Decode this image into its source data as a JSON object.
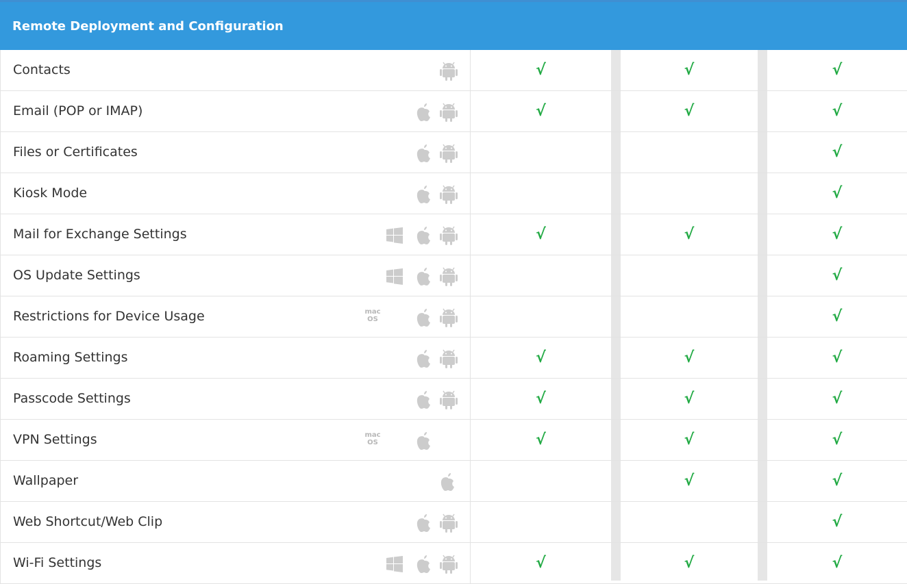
{
  "header": {
    "title": "Remote Deployment and Configuration"
  },
  "check_symbol": "√",
  "colors": {
    "header_bg": "#3399dd",
    "check": "#22aa44",
    "icon": "#cccccc",
    "gap": "#e6e6e6"
  },
  "rows": [
    {
      "label": "Contacts",
      "platforms": [
        "android-icon"
      ],
      "checks": [
        true,
        true,
        true
      ]
    },
    {
      "label": "Email (POP or IMAP)",
      "platforms": [
        "apple-icon",
        "android-icon"
      ],
      "checks": [
        true,
        true,
        true
      ]
    },
    {
      "label": "Files or Certificates",
      "platforms": [
        "apple-icon",
        "android-icon"
      ],
      "checks": [
        false,
        false,
        true
      ]
    },
    {
      "label": "Kiosk Mode",
      "platforms": [
        "apple-icon",
        "android-icon"
      ],
      "checks": [
        false,
        false,
        true
      ]
    },
    {
      "label": "Mail for Exchange Settings",
      "platforms": [
        "windows-icon",
        "apple-icon",
        "android-icon"
      ],
      "checks": [
        true,
        true,
        true
      ]
    },
    {
      "label": "OS Update Settings",
      "platforms": [
        "windows-icon",
        "apple-icon",
        "android-icon"
      ],
      "checks": [
        false,
        false,
        true
      ]
    },
    {
      "label": "Restrictions for Device Usage",
      "platforms": [
        "macos-icon",
        "apple-icon",
        "android-icon"
      ],
      "checks": [
        false,
        false,
        true
      ]
    },
    {
      "label": "Roaming Settings",
      "platforms": [
        "apple-icon",
        "android-icon"
      ],
      "checks": [
        true,
        true,
        true
      ]
    },
    {
      "label": "Passcode Settings",
      "platforms": [
        "apple-icon",
        "android-icon"
      ],
      "checks": [
        true,
        true,
        true
      ]
    },
    {
      "label": "VPN Settings",
      "platforms": [
        "macos-icon",
        "apple-icon"
      ],
      "checks": [
        true,
        true,
        true
      ]
    },
    {
      "label": "Wallpaper",
      "platforms": [
        "apple-icon"
      ],
      "checks": [
        false,
        true,
        true
      ]
    },
    {
      "label": "Web Shortcut/Web Clip",
      "platforms": [
        "apple-icon",
        "android-icon"
      ],
      "checks": [
        false,
        false,
        true
      ]
    },
    {
      "label": "Wi-Fi Settings",
      "platforms": [
        "windows-icon",
        "apple-icon",
        "android-icon"
      ],
      "checks": [
        true,
        true,
        true
      ]
    }
  ],
  "macos_text": {
    "line1": "mac",
    "line2": "OS"
  }
}
